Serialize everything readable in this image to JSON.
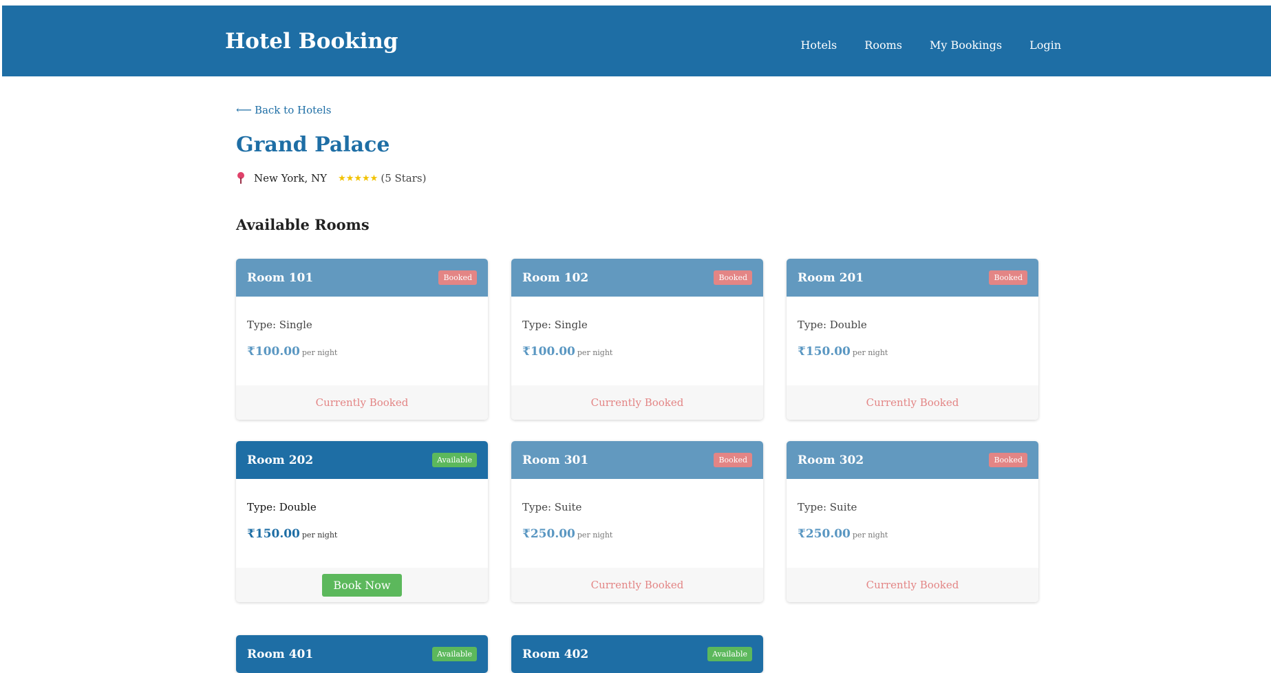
{
  "header": {
    "brand": "Hotel Booking",
    "nav": [
      "Hotels",
      "Rooms",
      "My Bookings",
      "Login"
    ]
  },
  "page": {
    "back_arrow": "⟵",
    "back_label": "Back to Hotels",
    "hotel_name": "Grand Palace",
    "location": "New York, NY",
    "stars": "★★★★★",
    "stars_label": "(5 Stars)",
    "rating": 5,
    "section_title": "Available Rooms"
  },
  "labels": {
    "type_prefix": "Type: ",
    "per_night": "per night",
    "booked_badge": "Booked",
    "available_badge": "Available",
    "currently_booked": "Currently Booked",
    "book_now": "Book Now"
  },
  "rooms": [
    {
      "name": "Room 101",
      "type": "Single",
      "price": "₹100.00",
      "status": "Booked",
      "action": "Currently Booked"
    },
    {
      "name": "Room 102",
      "type": "Single",
      "price": "₹100.00",
      "status": "Booked",
      "action": "Currently Booked"
    },
    {
      "name": "Room 201",
      "type": "Double",
      "price": "₹150.00",
      "status": "Booked",
      "action": "Currently Booked"
    },
    {
      "name": "Room 202",
      "type": "Double",
      "price": "₹150.00",
      "status": "Available",
      "action": "Book Now"
    },
    {
      "name": "Room 301",
      "type": "Suite",
      "price": "₹250.00",
      "status": "Booked",
      "action": "Currently Booked"
    },
    {
      "name": "Room 302",
      "type": "Suite",
      "price": "₹250.00",
      "status": "Booked",
      "action": "Currently Booked"
    },
    {
      "name": "Room 401",
      "status": "Available"
    },
    {
      "name": "Room 402",
      "status": "Available"
    }
  ],
  "colors": {
    "primary": "#1e6ea5",
    "primary_faded": "#6299bf",
    "booked": "#e38585",
    "available": "#5cb85c",
    "star": "#f2c200",
    "pin": "#e0426a"
  }
}
